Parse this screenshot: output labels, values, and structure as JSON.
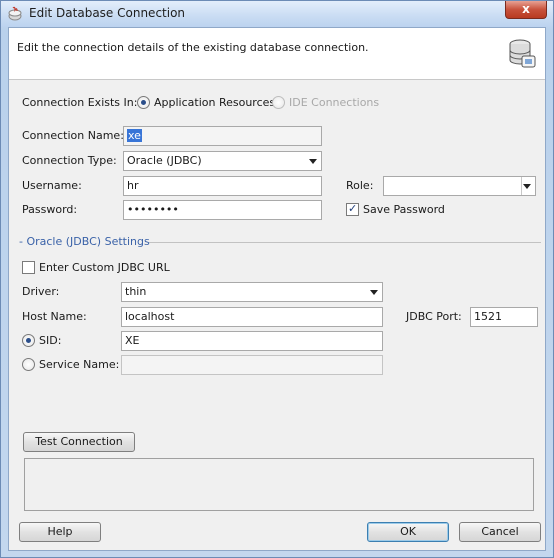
{
  "window": {
    "title": "Edit Database Connection",
    "close_label": "x"
  },
  "header": {
    "description": "Edit the connection details of the existing database connection."
  },
  "connection_exists_in": {
    "label": "Connection Exists In:",
    "options": [
      {
        "label": "Application Resources",
        "selected": true,
        "enabled": true
      },
      {
        "label": "IDE Connections",
        "selected": false,
        "enabled": false
      }
    ]
  },
  "fields": {
    "connection_name": {
      "label": "Connection Name:",
      "value": "xe"
    },
    "connection_type": {
      "label": "Connection Type:",
      "value": "Oracle (JDBC)"
    },
    "username": {
      "label": "Username:",
      "value": "hr"
    },
    "role": {
      "label": "Role:",
      "value": ""
    },
    "password": {
      "label": "Password:",
      "value": "••••••••"
    },
    "save_password": {
      "label": "Save Password",
      "checked": true
    }
  },
  "oracle_settings": {
    "section_title": "- Oracle (JDBC) Settings",
    "custom_url": {
      "label": "Enter Custom JDBC URL",
      "checked": false
    },
    "driver": {
      "label": "Driver:",
      "value": "thin"
    },
    "host_name": {
      "label": "Host Name:",
      "value": "localhost"
    },
    "jdbc_port": {
      "label": "JDBC Port:",
      "value": "1521"
    },
    "sid": {
      "label": "SID:",
      "value": "XE",
      "selected": true
    },
    "service_name": {
      "label": "Service Name:",
      "value": "",
      "selected": false
    }
  },
  "buttons": {
    "test_connection": "Test Connection",
    "help": "Help",
    "ok": "OK",
    "cancel": "Cancel"
  },
  "colors": {
    "section_title": "#3a62a8",
    "selection": "#3875d7"
  }
}
